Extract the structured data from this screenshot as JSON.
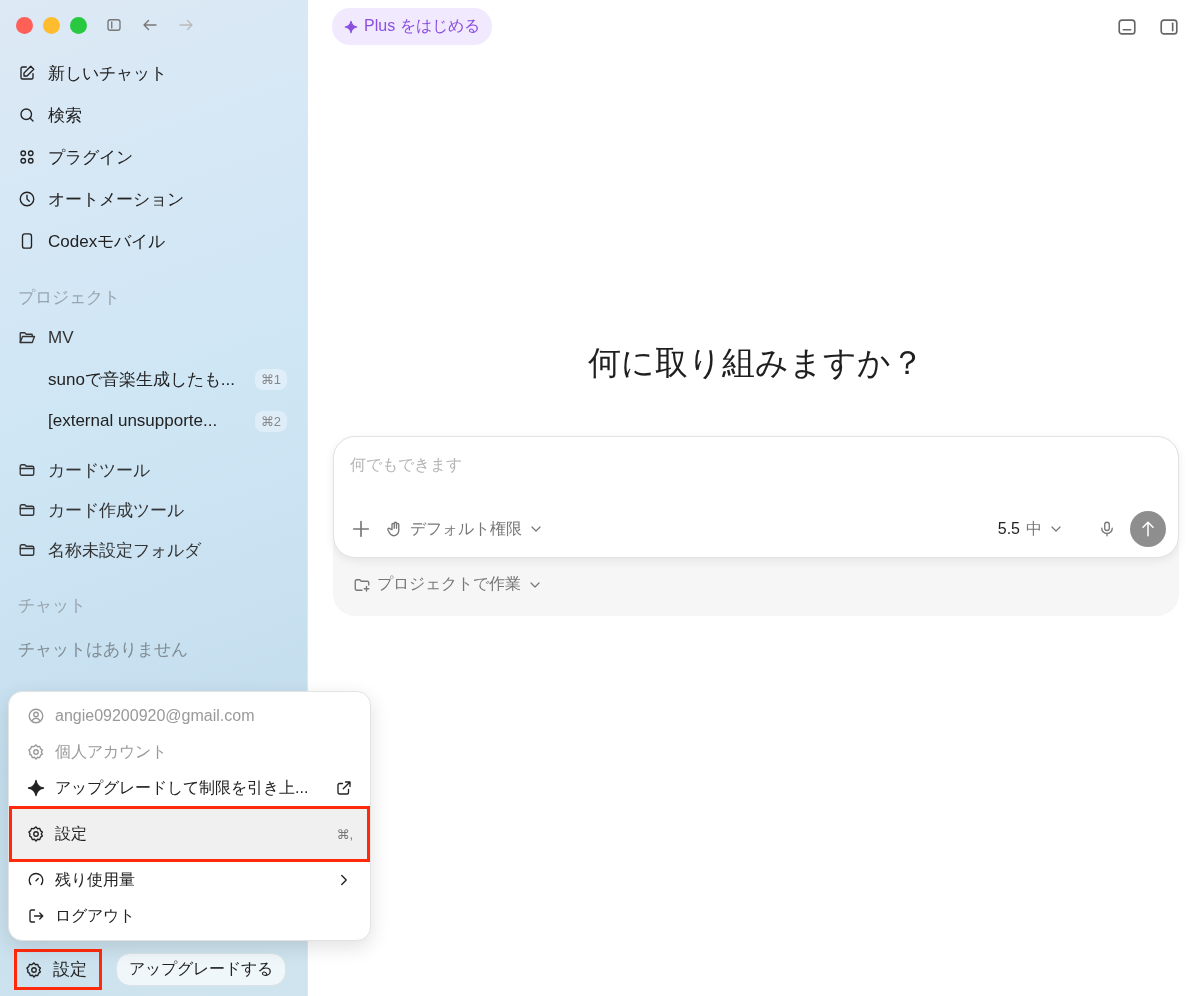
{
  "sidebar": {
    "nav": [
      {
        "label": "新しいチャット"
      },
      {
        "label": "検索"
      },
      {
        "label": "プラグイン"
      },
      {
        "label": "オートメーション"
      },
      {
        "label": "Codexモバイル"
      }
    ],
    "projects_heading": "プロジェクト",
    "projects": [
      {
        "label": "MV",
        "expanded": true,
        "children": [
          {
            "label": "sunoで音楽生成したも...",
            "shortcut": "⌘1"
          },
          {
            "label": "[external unsupporte...",
            "shortcut": "⌘2"
          }
        ]
      },
      {
        "label": "カードツール",
        "expanded": false
      },
      {
        "label": "カード作成ツール",
        "expanded": false
      },
      {
        "label": "名称未設定フォルダ",
        "expanded": false
      }
    ],
    "chats_heading": "チャット",
    "chats_empty": "チャットはありません",
    "settings_button": {
      "label": "設定",
      "highlighted": true
    },
    "upgrade_button": {
      "label": "アップグレードする"
    }
  },
  "header": {
    "plus_button": "Plus をはじめる"
  },
  "main": {
    "heading": "何に取り組みますか？",
    "composer": {
      "placeholder": "何でもできます",
      "permission": "デフォルト権限",
      "model": "5.5",
      "effort": "中",
      "project_button": "プロジェクトで作業"
    }
  },
  "account_menu": {
    "items": [
      {
        "label": "angie09200920@gmail.com",
        "disabled": true,
        "selected": false,
        "highlighted": false,
        "external": false,
        "submenu": false
      },
      {
        "label": "個人アカウント",
        "disabled": true,
        "selected": false,
        "highlighted": false,
        "external": false,
        "submenu": false
      },
      {
        "label": "アップグレードして制限を引き上...",
        "disabled": false,
        "selected": false,
        "highlighted": false,
        "external": true,
        "submenu": false
      },
      {
        "label": "設定",
        "shortcut": "⌘,",
        "disabled": false,
        "selected": true,
        "highlighted": true,
        "external": false,
        "submenu": false
      },
      {
        "label": "残り使用量",
        "disabled": false,
        "selected": false,
        "highlighted": false,
        "external": false,
        "submenu": true
      },
      {
        "label": "ログアウト",
        "disabled": false,
        "selected": false,
        "highlighted": false,
        "external": false,
        "submenu": false
      }
    ]
  }
}
